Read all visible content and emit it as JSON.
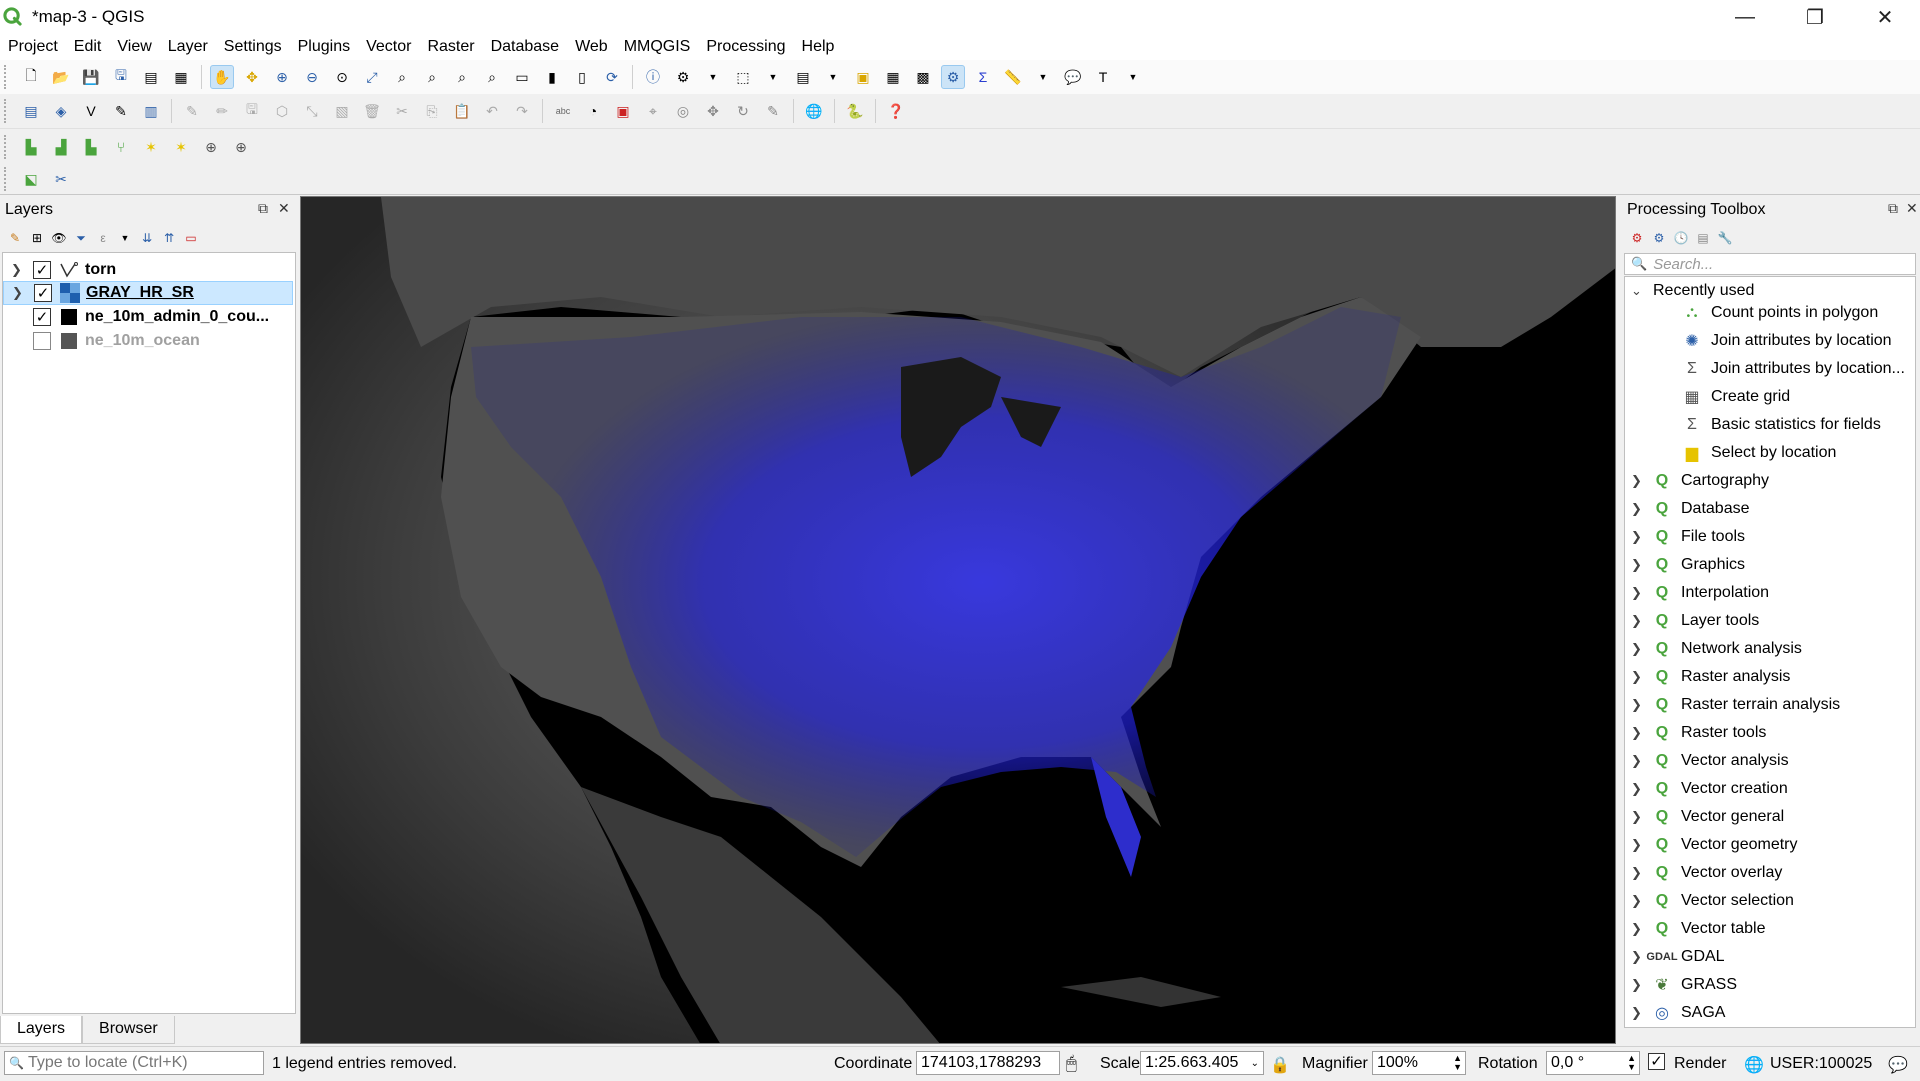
{
  "window": {
    "title": "*map-3 - QGIS",
    "minimize": "—",
    "restore": "❐",
    "close": "✕"
  },
  "menu": [
    "Project",
    "Edit",
    "View",
    "Layer",
    "Settings",
    "Plugins",
    "Vector",
    "Raster",
    "Database",
    "Web",
    "MMQGIS",
    "Processing",
    "Help"
  ],
  "layers_panel": {
    "title": "Layers",
    "layers": [
      {
        "name": "torn",
        "checked": true,
        "icon": "line-layer-icon"
      },
      {
        "name": "GRAY_HR_SR",
        "checked": true,
        "icon": "raster-layer-icon",
        "selected": true
      },
      {
        "name": "ne_10m_admin_0_cou...",
        "checked": true,
        "icon": "polygon-layer-icon"
      },
      {
        "name": "ne_10m_ocean",
        "checked": false,
        "icon": "polygon-layer-icon"
      }
    ],
    "tabs": [
      "Layers",
      "Browser"
    ]
  },
  "processing": {
    "title": "Processing Toolbox",
    "search_placeholder": "Search...",
    "recently_used_label": "Recently used",
    "recent": [
      {
        "label": "Count points in polygon",
        "icon": "count-points-icon"
      },
      {
        "label": "Join attributes by location",
        "icon": "join-icon"
      },
      {
        "label": "Join attributes by location...",
        "icon": "sigma-icon"
      },
      {
        "label": "Create grid",
        "icon": "grid-icon"
      },
      {
        "label": "Basic statistics for fields",
        "icon": "sigma-icon"
      },
      {
        "label": "Select by location",
        "icon": "select-icon"
      }
    ],
    "groups": [
      "Cartography",
      "Database",
      "File tools",
      "Graphics",
      "Interpolation",
      "Layer tools",
      "Network analysis",
      "Raster analysis",
      "Raster terrain analysis",
      "Raster tools",
      "Vector analysis",
      "Vector creation",
      "Vector general",
      "Vector geometry",
      "Vector overlay",
      "Vector selection",
      "Vector table"
    ],
    "providers": [
      {
        "label": "GDAL",
        "icon": "gdal-icon"
      },
      {
        "label": "GRASS",
        "icon": "grass-icon"
      },
      {
        "label": "SAGA",
        "icon": "saga-icon"
      }
    ]
  },
  "status": {
    "locate_placeholder": "Type to locate (Ctrl+K)",
    "message": "1 legend entries removed.",
    "coordinate_label": "Coordinate",
    "coordinate_value": "174103,1788293",
    "scale_label": "Scale",
    "scale_value": "1:25.663.405",
    "magnifier_label": "Magnifier",
    "magnifier_value": "100%",
    "rotation_label": "Rotation",
    "rotation_value": "0,0 °",
    "render_label": "Render",
    "crs_label": "USER:100025"
  },
  "colors": {
    "accent_green": "#4aa43d",
    "torn_blue": "#2a2aff",
    "selection": "#cce8ff"
  }
}
